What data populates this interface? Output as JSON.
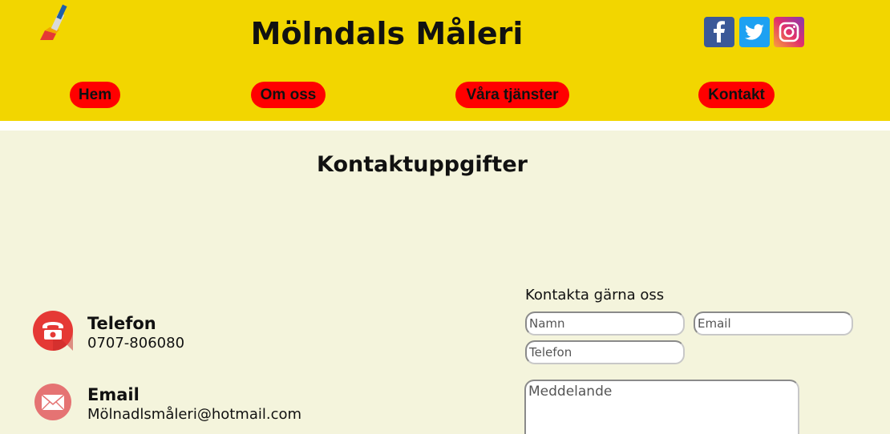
{
  "header": {
    "title": "Mölndals Måleri",
    "logo_icon": "paintbrush-icon",
    "social": [
      {
        "name": "facebook-icon",
        "color": "#3b5998"
      },
      {
        "name": "twitter-icon",
        "color": "#1da1f2"
      },
      {
        "name": "instagram-icon",
        "color": "#c13584"
      }
    ]
  },
  "nav": {
    "items": [
      "Hem",
      "Om oss",
      "Våra tjänster",
      "Kontakt"
    ],
    "button_color": "#ff0000"
  },
  "colors": {
    "header_bg": "#f2d600",
    "main_bg": "#f4f4dc",
    "icon_red": "#e53935"
  },
  "main": {
    "title": "Kontaktuppgifter",
    "phone": {
      "label": "Telefon",
      "value": "0707-806080",
      "icon": "telephone-icon"
    },
    "email": {
      "label": "Email",
      "value": "Mölnadlsmåleri@hotmail.com",
      "icon": "envelope-icon"
    }
  },
  "form": {
    "heading": "Kontakta gärna oss",
    "name_placeholder": "Namn",
    "email_placeholder": "Email",
    "phone_placeholder": "Telefon",
    "message_placeholder": "Meddelande"
  }
}
